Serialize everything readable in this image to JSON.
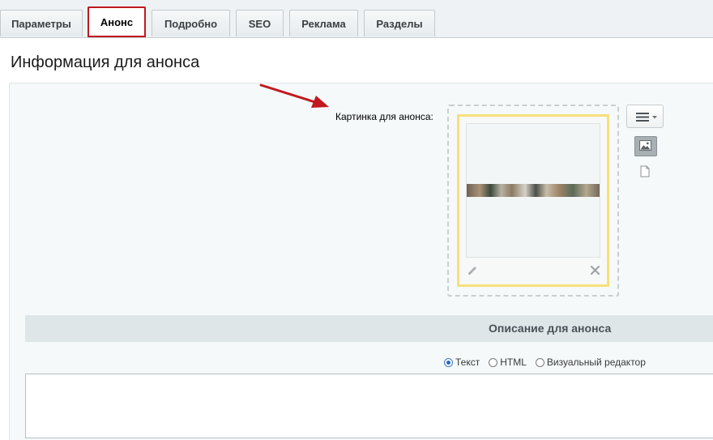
{
  "tabs": [
    {
      "label": "Параметры",
      "active": false
    },
    {
      "label": "Анонс",
      "active": true
    },
    {
      "label": "Подробно",
      "active": false
    },
    {
      "label": "SEO",
      "active": false
    },
    {
      "label": "Реклама",
      "active": false
    },
    {
      "label": "Разделы",
      "active": false
    }
  ],
  "section": {
    "title": "Информация для анонса"
  },
  "picture": {
    "label": "Картинка для анонса:",
    "icons": {
      "edit": "pencil-icon",
      "remove": "close-icon",
      "menu": "hamburger-menu-icon",
      "image_source": "image-icon",
      "file_source": "file-icon"
    }
  },
  "description": {
    "header": "Описание для анонса",
    "modes": [
      {
        "label": "Текст",
        "checked": true
      },
      {
        "label": "HTML",
        "checked": false
      },
      {
        "label": "Визуальный редактор",
        "checked": false
      }
    ],
    "value": ""
  },
  "colors": {
    "active_tab_border": "#c0191e",
    "annotation_arrow": "#c0191e",
    "image_frame_highlight": "#f7e07c",
    "radio_selected": "#2a66c0"
  }
}
